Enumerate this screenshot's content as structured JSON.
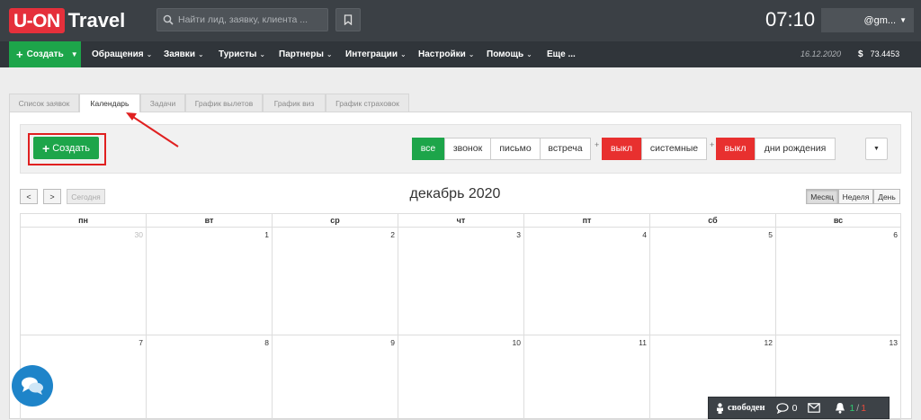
{
  "header": {
    "logo_box": "U-ON",
    "logo_word": "Travel",
    "search_placeholder": "Найти лид, заявку, клиента ...",
    "time": "07:10",
    "user": "@gm..."
  },
  "nav": {
    "create_label": "Создать",
    "items": [
      "Обращения",
      "Заявки",
      "Туристы",
      "Партнеры",
      "Интеграции",
      "Настройки",
      "Помощь",
      "Еще ..."
    ],
    "date": "16.12.2020",
    "balance_symbol": "$",
    "balance": "73.4453"
  },
  "tabs": [
    "Список заявок",
    "Календарь",
    "Задачи",
    "График вылетов",
    "График виз",
    "График страховок"
  ],
  "active_tab": "Календарь",
  "toolbar": {
    "create_label": "Создать",
    "filters": [
      "все",
      "звонок",
      "письмо",
      "встреча"
    ],
    "plus": "+",
    "off_label": "выкл",
    "system_label": "системные",
    "birthday_label": "дни рождения"
  },
  "calendar": {
    "title": "декабрь 2020",
    "prev": "<",
    "next": ">",
    "today": "Сегодня",
    "views": [
      "Месяц",
      "Неделя",
      "День"
    ],
    "active_view": "Месяц",
    "weekdays": [
      "пн",
      "вт",
      "ср",
      "чт",
      "пт",
      "сб",
      "вс"
    ],
    "weeks": [
      [
        "30",
        "1",
        "2",
        "3",
        "4",
        "5",
        "6"
      ],
      [
        "7",
        "8",
        "9",
        "10",
        "11",
        "12",
        "13"
      ]
    ]
  },
  "statusbar": {
    "free_label": "свободен",
    "chat_count": "0",
    "bell_a": "1",
    "bell_sep": "/",
    "bell_b": "1"
  },
  "colors": {
    "topbar": "#3b4045",
    "navbar": "#30353a",
    "green": "#1da54a",
    "red": "#e8302f",
    "logo_red": "#e5303b",
    "chat_blue": "#1e84c9"
  }
}
